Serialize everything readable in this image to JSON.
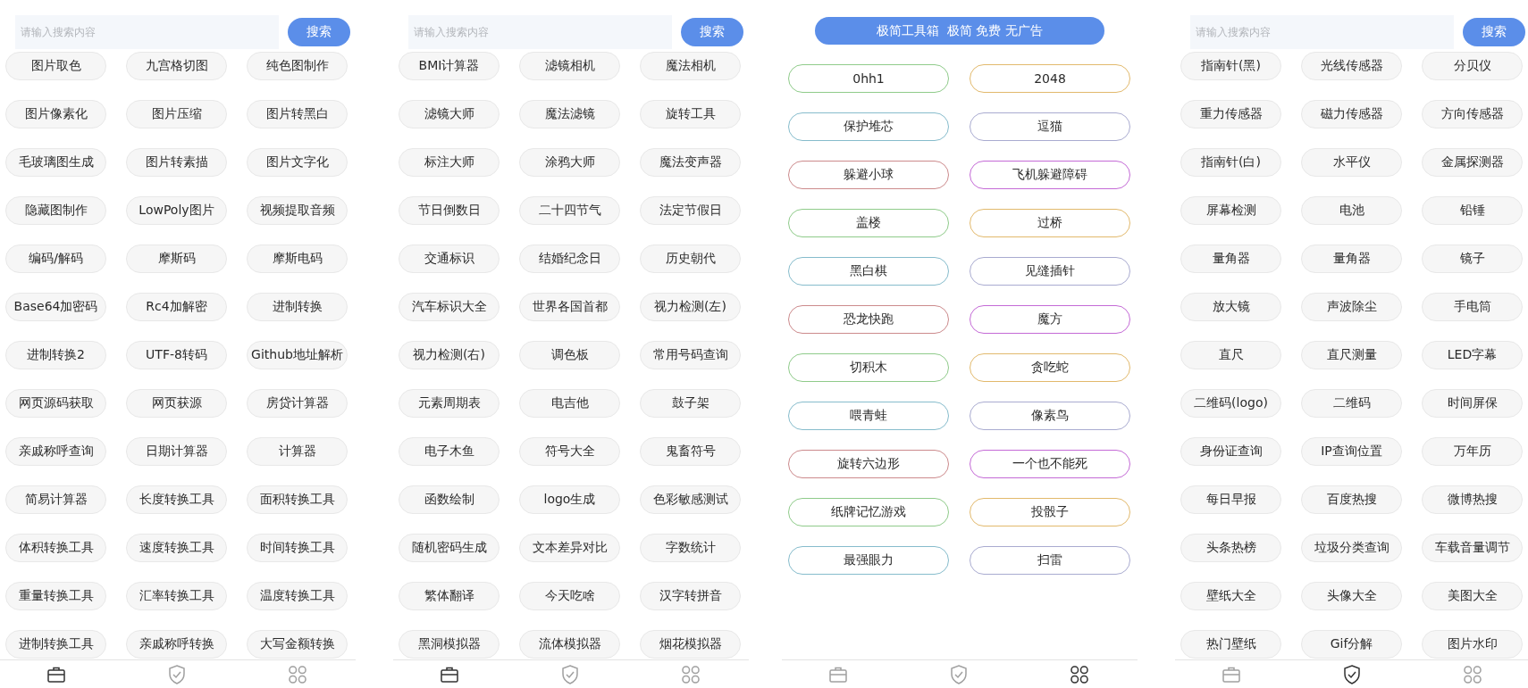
{
  "screens": [
    {
      "kind": "tools",
      "search": {
        "placeholder": "请输入搜索内容",
        "button": "搜索"
      },
      "tools": [
        "图片取色",
        "九宫格切图",
        "纯色图制作",
        "图片像素化",
        "图片压缩",
        "图片转黑白",
        "毛玻璃图生成",
        "图片转素描",
        "图片文字化",
        "隐藏图制作",
        "LowPoly图片",
        "视频提取音频",
        "编码/解码",
        "摩斯码",
        "摩斯电码",
        "Base64加密码",
        "Rc4加解密",
        "进制转换",
        "进制转换2",
        "UTF-8转码",
        "Github地址解析",
        "网页源码获取",
        "网页获源",
        "房贷计算器",
        "亲戚称呼查询",
        "日期计算器",
        "计算器",
        "简易计算器",
        "长度转换工具",
        "面积转换工具",
        "体积转换工具",
        "速度转换工具",
        "时间转换工具",
        "重量转换工具",
        "汇率转换工具",
        "温度转换工具",
        "进制转换工具",
        "亲戚称呼转换",
        "大写金额转换"
      ],
      "nav": [
        {
          "selected": true
        },
        {
          "selected": false
        },
        {
          "selected": false
        }
      ]
    },
    {
      "kind": "tools",
      "search": {
        "placeholder": "请输入搜索内容",
        "button": "搜索"
      },
      "tools": [
        "BMI计算器",
        "滤镜相机",
        "魔法相机",
        "滤镜大师",
        "魔法滤镜",
        "旋转工具",
        "标注大师",
        "涂鸦大师",
        "魔法变声器",
        "节日倒数日",
        "二十四节气",
        "法定节假日",
        "交通标识",
        "结婚纪念日",
        "历史朝代",
        "汽车标识大全",
        "世界各国首都",
        "视力检测(左)",
        "视力检测(右)",
        "调色板",
        "常用号码查询",
        "元素周期表",
        "电吉他",
        "鼓子架",
        "电子木鱼",
        "符号大全",
        "鬼畜符号",
        "函数绘制",
        "logo生成",
        "色彩敏感测试",
        "随机密码生成",
        "文本差异对比",
        "字数统计",
        "繁体翻译",
        "今天吃啥",
        "汉字转拼音",
        "黑洞模拟器",
        "流体模拟器",
        "烟花模拟器"
      ],
      "nav": [
        {
          "selected": true
        },
        {
          "selected": false
        },
        {
          "selected": false
        }
      ]
    },
    {
      "kind": "games",
      "banner": "极简工具箱  极简 免费 无广告",
      "games": [
        {
          "label": "0hh1",
          "color": "#8fcb8a"
        },
        {
          "label": "2048",
          "color": "#e2b96c"
        },
        {
          "label": "保护堆芯",
          "color": "#86bccc"
        },
        {
          "label": "逗猫",
          "color": "#a9abd0"
        },
        {
          "label": "躲避小球",
          "color": "#cc8a8c"
        },
        {
          "label": "飞机躲避障碍",
          "color": "#c46ad6"
        },
        {
          "label": "盖楼",
          "color": "#8fcb8a"
        },
        {
          "label": "过桥",
          "color": "#e2b96c"
        },
        {
          "label": "黑白棋",
          "color": "#86bccc"
        },
        {
          "label": "见缝插针",
          "color": "#a9abd0"
        },
        {
          "label": "恐龙快跑",
          "color": "#cc8a8c"
        },
        {
          "label": "魔方",
          "color": "#c46ad6"
        },
        {
          "label": "切积木",
          "color": "#8fcb8a"
        },
        {
          "label": "贪吃蛇",
          "color": "#e2b96c"
        },
        {
          "label": "喂青蛙",
          "color": "#86bccc"
        },
        {
          "label": "像素鸟",
          "color": "#a9abd0"
        },
        {
          "label": "旋转六边形",
          "color": "#cc8a8c"
        },
        {
          "label": "一个也不能死",
          "color": "#c46ad6"
        },
        {
          "label": "纸牌记忆游戏",
          "color": "#8fcb8a"
        },
        {
          "label": "投骰子",
          "color": "#e2b96c"
        },
        {
          "label": "最强眼力",
          "color": "#86bccc"
        },
        {
          "label": "扫雷",
          "color": "#a9abd0"
        }
      ],
      "nav": [
        {
          "selected": false
        },
        {
          "selected": false
        },
        {
          "selected": true
        }
      ]
    },
    {
      "kind": "tools",
      "search": {
        "placeholder": "请输入搜索内容",
        "button": "搜索"
      },
      "tools": [
        "指南针(黑)",
        "光线传感器",
        "分贝仪",
        "重力传感器",
        "磁力传感器",
        "方向传感器",
        "指南针(白)",
        "水平仪",
        "金属探测器",
        "屏幕检测",
        "电池",
        "铅锤",
        "量角器",
        "量角器",
        "镜子",
        "放大镜",
        "声波除尘",
        "手电筒",
        "直尺",
        "直尺测量",
        "LED字幕",
        "二维码(logo)",
        "二维码",
        "时间屏保",
        "身份证查询",
        "IP查询位置",
        "万年历",
        "每日早报",
        "百度热搜",
        "微博热搜",
        "头条热榜",
        "垃圾分类查询",
        "车载音量调节",
        "壁纸大全",
        "头像大全",
        "美图大全",
        "热门壁纸",
        "Gif分解",
        "图片水印"
      ],
      "nav": [
        {
          "selected": false
        },
        {
          "selected": true
        },
        {
          "selected": false
        }
      ]
    }
  ]
}
